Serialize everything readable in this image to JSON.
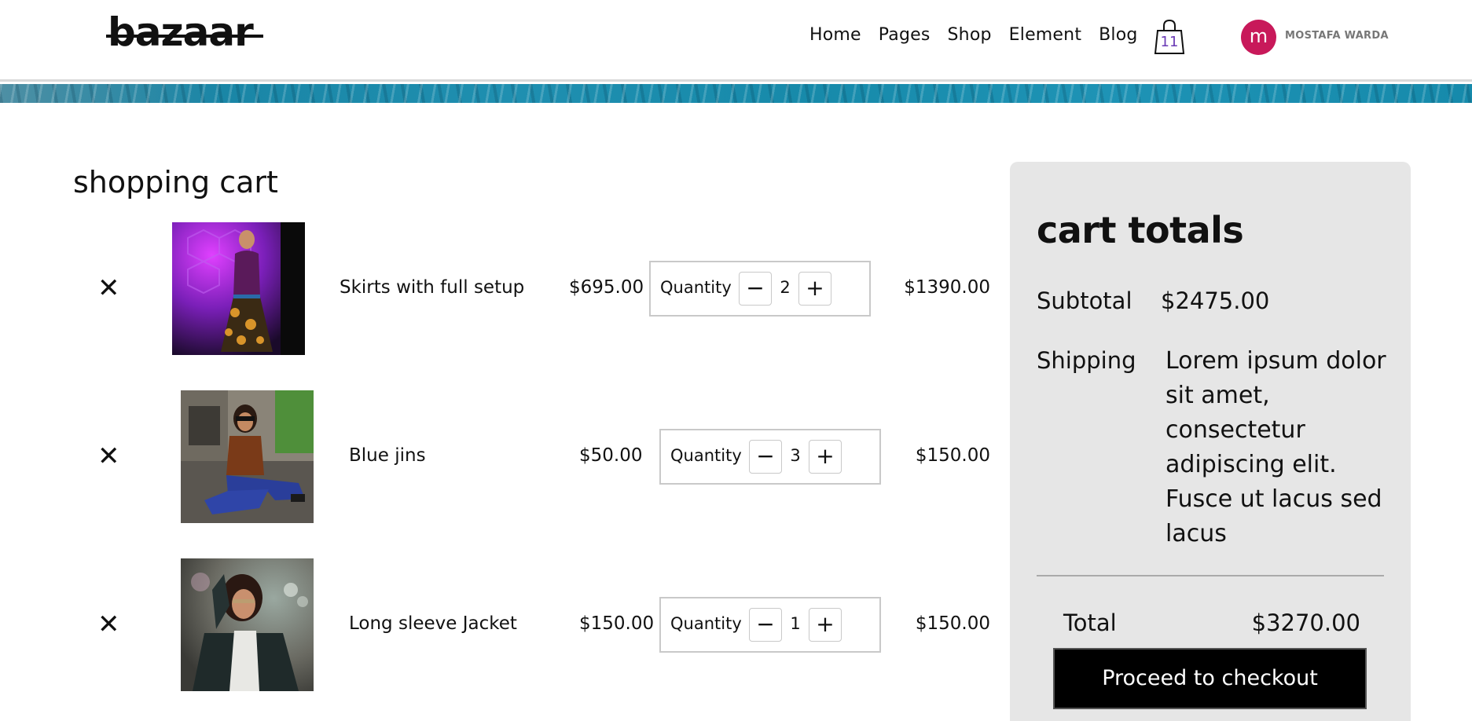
{
  "header": {
    "logo": "bazaar",
    "nav": [
      "Home",
      "Pages",
      "Shop",
      "Element",
      "Blog"
    ],
    "cart_count": "11",
    "avatar_letter": "m",
    "user_name": "MOSTAFA WARDA",
    "avatar_color": "#c8195a"
  },
  "cart": {
    "title": "shopping cart",
    "quantity_label": "Quantity",
    "minus_symbol": "−",
    "plus_symbol": "+",
    "remove_symbol": "✕",
    "items": [
      {
        "name": "Skirts with full setup",
        "price": "$695.00",
        "quantity": "2",
        "total": "$1390.00"
      },
      {
        "name": "Blue jins",
        "price": "$50.00",
        "quantity": "3",
        "total": "$150.00"
      },
      {
        "name": "Long sleeve Jacket",
        "price": "$150.00",
        "quantity": "1",
        "total": "$150.00"
      }
    ]
  },
  "totals": {
    "title": "cart totals",
    "subtotal_label": "Subtotal",
    "subtotal_value": "$2475.00",
    "shipping_label": "Shipping",
    "shipping_text": "Lorem ipsum dolor sit amet, consectetur adipiscing elit. Fusce ut lacus sed lacus",
    "total_label": "Total",
    "total_value": "$3270.00",
    "checkout_label": "Proceed to checkout"
  }
}
